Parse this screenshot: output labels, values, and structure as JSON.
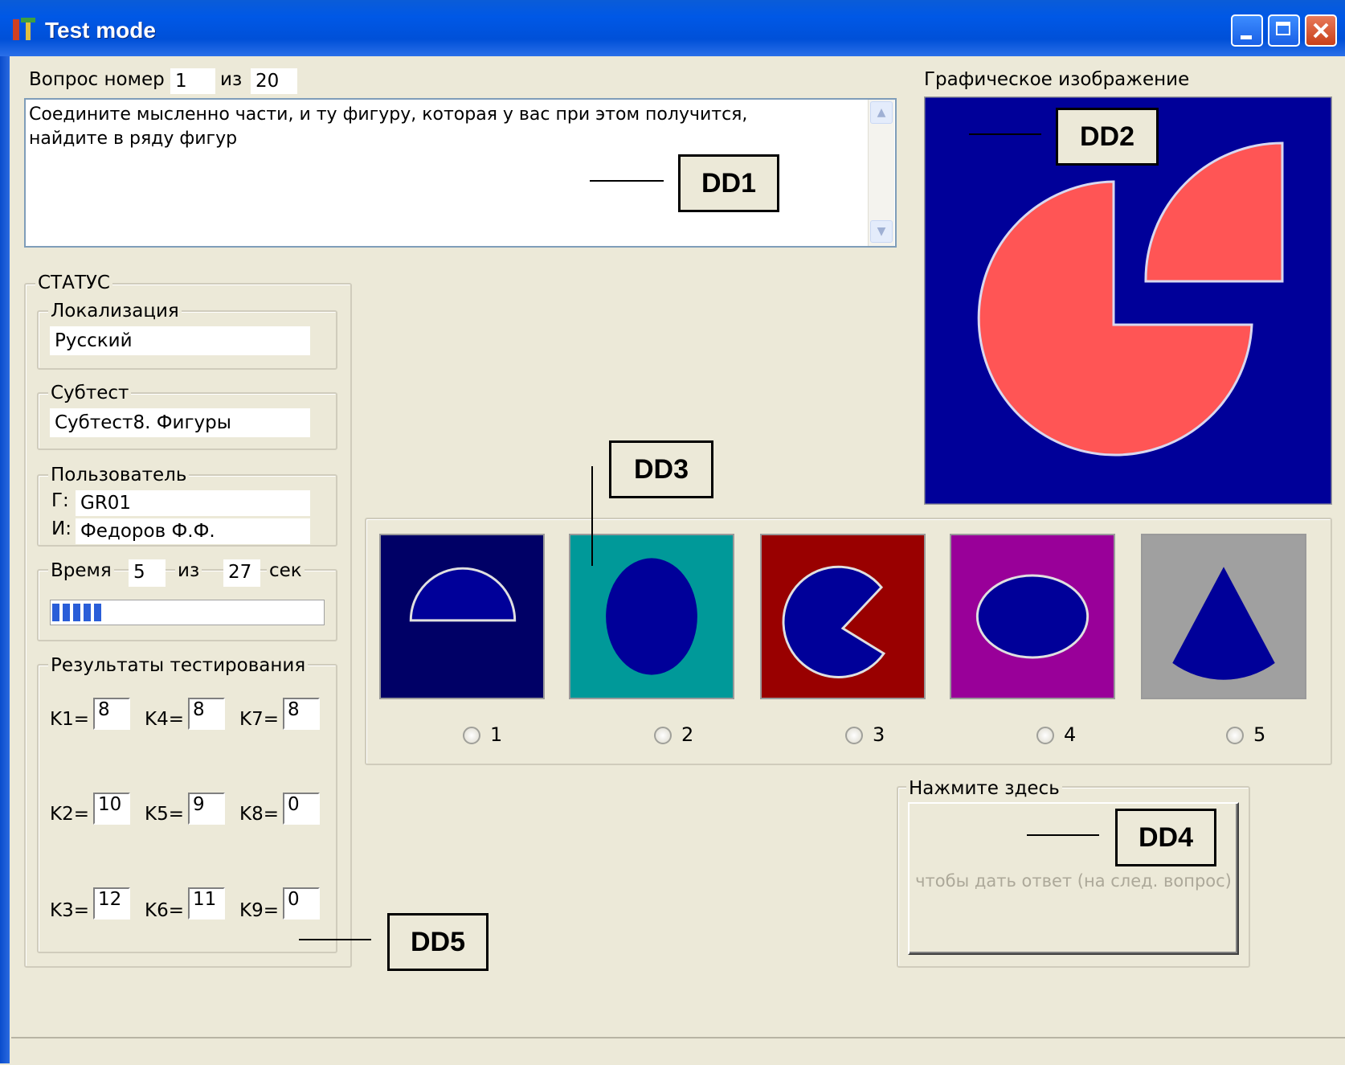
{
  "window": {
    "title": "Test mode"
  },
  "question": {
    "label": "Вопрос  номер",
    "number": "1",
    "of_label": "из",
    "total": "20",
    "text": "Соедините мысленно части, и ту фигуру, которая у вас при этом получится, найдите в ряду фигур"
  },
  "graphic": {
    "label": "Графическое изображение"
  },
  "status": {
    "title": "СТАТУС",
    "localization": {
      "label": "Локализация",
      "value": "Русский"
    },
    "subtest": {
      "label": "Субтест",
      "value": "Субтест8. Фигуры"
    },
    "user": {
      "label": "Пользователь",
      "group_prefix": "Г:",
      "group": "GR01",
      "name_prefix": "И:",
      "name": "Федоров Ф.Ф."
    },
    "time": {
      "label": "Время",
      "elapsed": "5",
      "of_label": "из",
      "total": "27",
      "unit": "сек",
      "progress": 0.185
    },
    "results": {
      "label": "Результаты тестирования",
      "k": [
        {
          "label": "K1=",
          "value": "8"
        },
        {
          "label": "K4=",
          "value": "8"
        },
        {
          "label": "K7=",
          "value": "8"
        },
        {
          "label": "K2=",
          "value": "10"
        },
        {
          "label": "K5=",
          "value": "9"
        },
        {
          "label": "K8=",
          "value": "0"
        },
        {
          "label": "K3=",
          "value": "12"
        },
        {
          "label": "K6=",
          "value": "11"
        },
        {
          "label": "K9=",
          "value": "0"
        }
      ]
    }
  },
  "options": [
    {
      "label": "1",
      "bg": "#000066",
      "shape": "half-circle"
    },
    {
      "label": "2",
      "bg": "#009999",
      "shape": "ellipse"
    },
    {
      "label": "3",
      "bg": "#990000",
      "shape": "pacman"
    },
    {
      "label": "4",
      "bg": "#990099",
      "shape": "ellipse-wide"
    },
    {
      "label": "5",
      "bg": "#a0a0a0",
      "shape": "sector-triangle"
    }
  ],
  "answer": {
    "group_label": "Нажмите здесь",
    "button_text": "чтобы дать ответ (на след. вопрос)"
  },
  "callouts": {
    "dd1": "DD1",
    "dd2": "DD2",
    "dd3": "DD3",
    "dd4": "DD4",
    "dd5": "DD5"
  },
  "colors": {
    "figure_fill": "#ff5555",
    "figure_bg": "#000099",
    "shape_fill": "#000099",
    "titlebar": "#0054e3"
  }
}
